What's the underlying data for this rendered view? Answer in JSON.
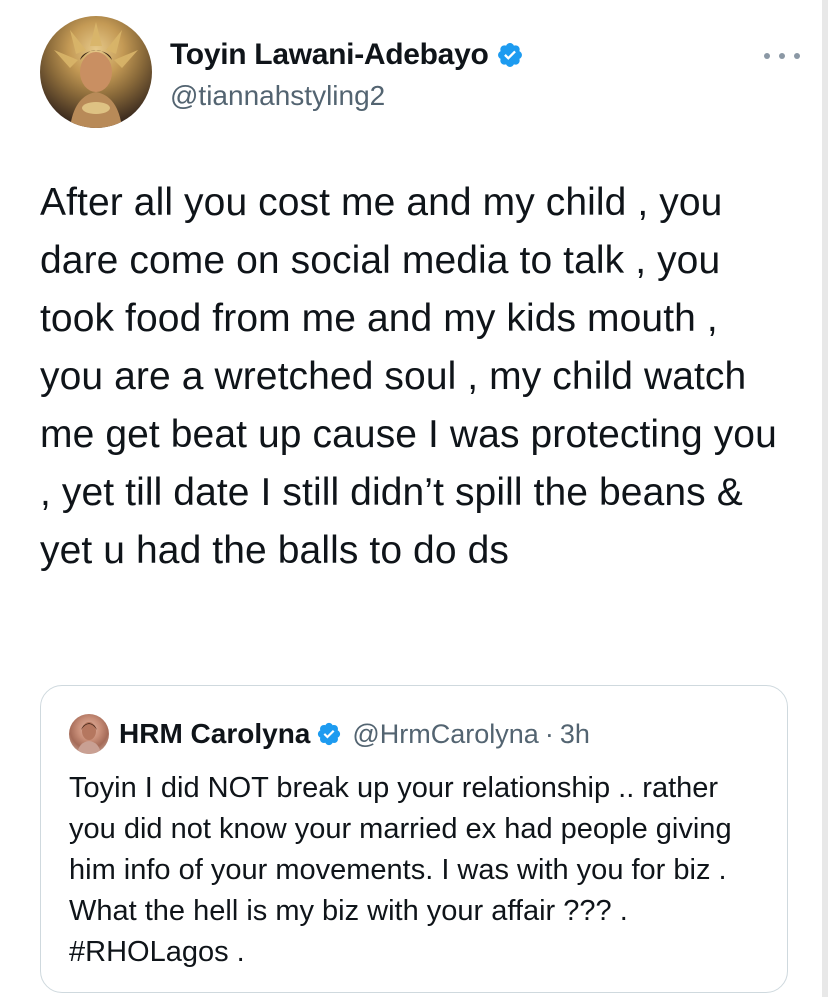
{
  "tweet": {
    "author": {
      "display_name": "Toyin Lawani-Adebayo",
      "handle": "@tiannahstyling2",
      "verified": true,
      "avatar_icon": "user-avatar-photo"
    },
    "more_icon": "more-horizontal-icon",
    "body": "After all you cost me and my child , you dare come on social media to talk , you took food from me and my kids mouth , you are a wretched soul , my child watch me get beat up cause I was protecting you , yet till date I still didn’t spill the beans & yet u had the balls to do ds"
  },
  "quoted_tweet": {
    "author": {
      "display_name": "HRM Carolyna",
      "handle": "@HrmCarolyna",
      "verified": true
    },
    "separator": "·",
    "time": "3h",
    "body": "Toyin I did NOT break up your relationship .. rather you did not know your married ex had people giving him info of your movements. I was with you for biz . What the hell is my biz with your affair ??? . #RHOLagos ."
  },
  "colors": {
    "text_primary": "#0f1419",
    "text_secondary": "#536471",
    "verified_blue": "#1d9bf0",
    "border": "#cfd9de"
  }
}
